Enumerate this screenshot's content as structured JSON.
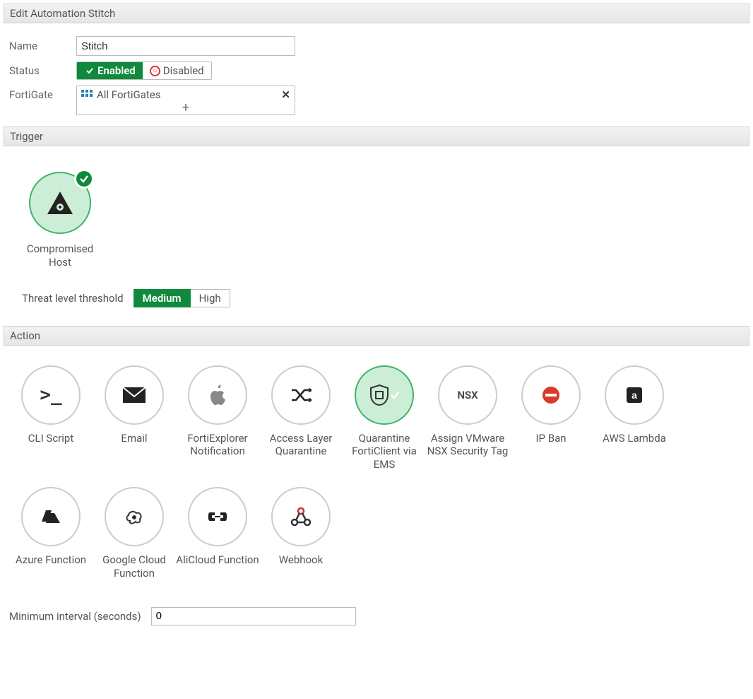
{
  "header": {
    "title": "Edit Automation Stitch"
  },
  "form": {
    "name_label": "Name",
    "name_value": "Stitch",
    "status_label": "Status",
    "status_enabled": "Enabled",
    "status_disabled": "Disabled",
    "status_active": "enabled",
    "fortigate_label": "FortiGate",
    "fortigate_value": "All FortiGates"
  },
  "trigger": {
    "section_title": "Trigger",
    "selected": "compromised-host",
    "items": [
      {
        "id": "compromised-host",
        "label": "Compromised Host"
      }
    ],
    "threshold_label": "Threat level threshold",
    "threshold_options": [
      "Medium",
      "High"
    ],
    "threshold_selected": "Medium"
  },
  "action": {
    "section_title": "Action",
    "selected": "quarantine-ems",
    "items": [
      {
        "id": "cli-script",
        "label": "CLI Script"
      },
      {
        "id": "email",
        "label": "Email"
      },
      {
        "id": "fortiexplorer",
        "label": "FortiExplorer Notification"
      },
      {
        "id": "access-layer",
        "label": "Access Layer Quarantine"
      },
      {
        "id": "quarantine-ems",
        "label": "Quarantine FortiClient via EMS"
      },
      {
        "id": "vmware-nsx",
        "label": "Assign VMware NSX Security Tag"
      },
      {
        "id": "ip-ban",
        "label": "IP Ban"
      },
      {
        "id": "aws-lambda",
        "label": "AWS Lambda"
      },
      {
        "id": "azure-func",
        "label": "Azure Function"
      },
      {
        "id": "gcp-func",
        "label": "Google Cloud Function"
      },
      {
        "id": "alicloud-func",
        "label": "AliCloud Function"
      },
      {
        "id": "webhook",
        "label": "Webhook"
      }
    ],
    "min_interval_label": "Minimum interval (seconds)",
    "min_interval_value": "0"
  }
}
